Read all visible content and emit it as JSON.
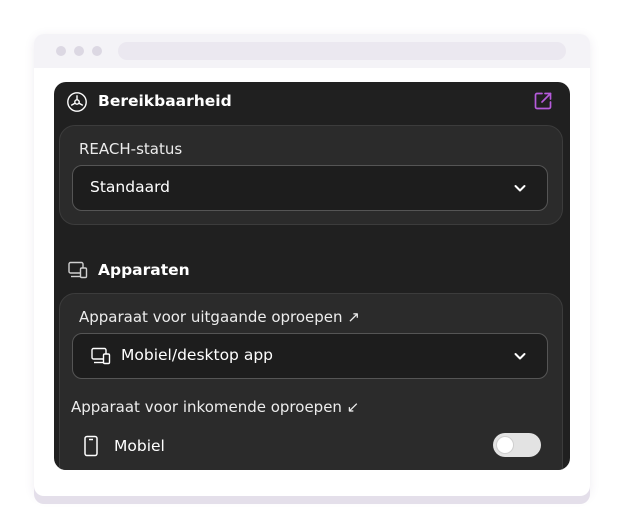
{
  "panel": {
    "title": "Bereikbaarheid",
    "title_icon": "reach-icon",
    "external_icon": "external-link-icon",
    "accent_color": "#b65bdc"
  },
  "reach": {
    "label": "REACH-status",
    "selected": "Standaard"
  },
  "devices": {
    "section_title": "Apparaten",
    "section_icon": "devices-icon",
    "outgoing_label": "Apparaat voor uitgaande oproepen ↗",
    "outgoing_selected": "Mobiel/desktop app",
    "incoming_label": "Apparaat voor inkomende oproepen ↙",
    "incoming_device": "Mobiel",
    "incoming_enabled": false
  }
}
